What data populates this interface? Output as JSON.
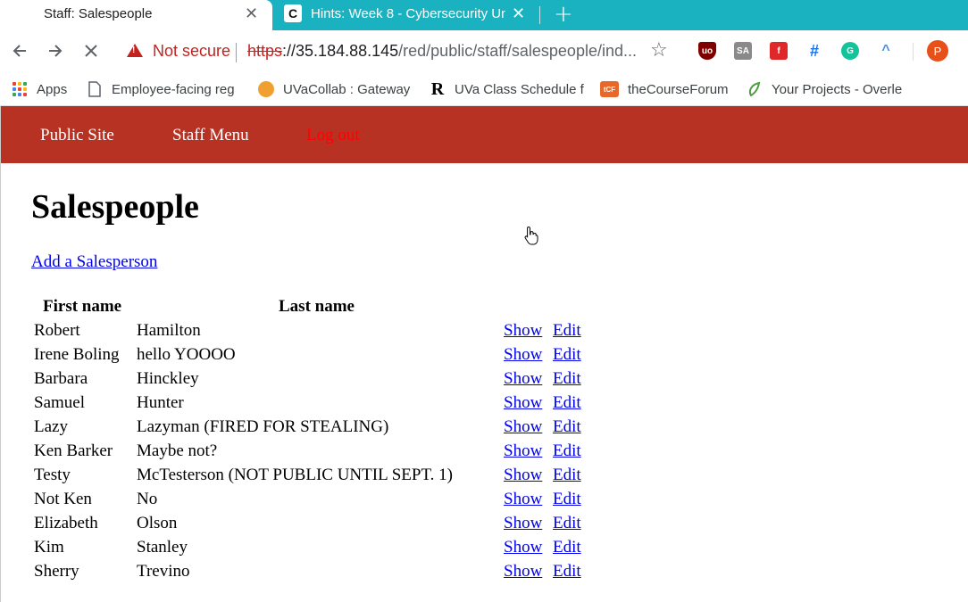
{
  "browser": {
    "tabs": [
      {
        "title": "Staff: Salespeople",
        "active": true
      },
      {
        "title": "Hints: Week 8 - Cybersecurity Un",
        "active": false,
        "favicon": "C"
      }
    ],
    "tab_close": "✕",
    "new_tab": "+",
    "security_label": "Not secure",
    "url_scheme": "https",
    "url_rest": "://35.184.88.145",
    "url_path": "/red/public/staff/salespeople/ind...",
    "bookmarks": [
      {
        "label": "Apps"
      },
      {
        "label": "Employee-facing reg"
      },
      {
        "label": "UVaCollab : Gateway"
      },
      {
        "label": "UVa Class Schedule f",
        "icon_text": "R"
      },
      {
        "label": "theCourseForum",
        "icon_text": "tCF"
      },
      {
        "label": "Your Projects - Overle"
      }
    ],
    "extensions": [
      {
        "icon": "ublock-icon",
        "text": "uo",
        "color": "#800000"
      },
      {
        "icon": "sa-icon",
        "text": "SA",
        "color": "#8a8a8a"
      },
      {
        "icon": "flipboard-icon",
        "text": "f",
        "color": "#e12828"
      },
      {
        "icon": "grid-icon",
        "text": "#",
        "color": "#1a73e8"
      },
      {
        "icon": "grammarly-icon",
        "text": "G",
        "color": "#15c39a"
      },
      {
        "icon": "rainbow-icon",
        "text": "^",
        "color": "#4a90d9"
      }
    ],
    "profile_initial": "P",
    "colors": {
      "tabstrip": "#1ab1c0",
      "insecure": "#c5221f"
    }
  },
  "nav": {
    "public_site": "Public Site",
    "staff_menu": "Staff Menu",
    "log_out": "Log out"
  },
  "page": {
    "title": "Salespeople",
    "add_link": "Add a Salesperson",
    "table": {
      "headers": [
        "First name",
        "Last name"
      ],
      "show_label": "Show",
      "edit_label": "Edit",
      "rows": [
        {
          "first": "Robert",
          "last": "Hamilton"
        },
        {
          "first": "Irene Boling",
          "last": "hello YOOOO"
        },
        {
          "first": "Barbara",
          "last": "Hinckley"
        },
        {
          "first": "Samuel",
          "last": "Hunter"
        },
        {
          "first": "Lazy",
          "last": "Lazyman (FIRED FOR STEALING)"
        },
        {
          "first": "Ken Barker",
          "last": "Maybe not?"
        },
        {
          "first": "Testy",
          "last": "McTesterson (NOT PUBLIC UNTIL SEPT. 1)"
        },
        {
          "first": "Not Ken",
          "last": "No"
        },
        {
          "first": "Elizabeth",
          "last": "Olson"
        },
        {
          "first": "Kim",
          "last": "Stanley"
        },
        {
          "first": "Sherry",
          "last": "Trevino"
        }
      ]
    }
  },
  "colors": {
    "nav_bg": "#b83224",
    "nav_text": "#ffffff",
    "logout_text": "#ff0000",
    "link": "#0000ee"
  }
}
